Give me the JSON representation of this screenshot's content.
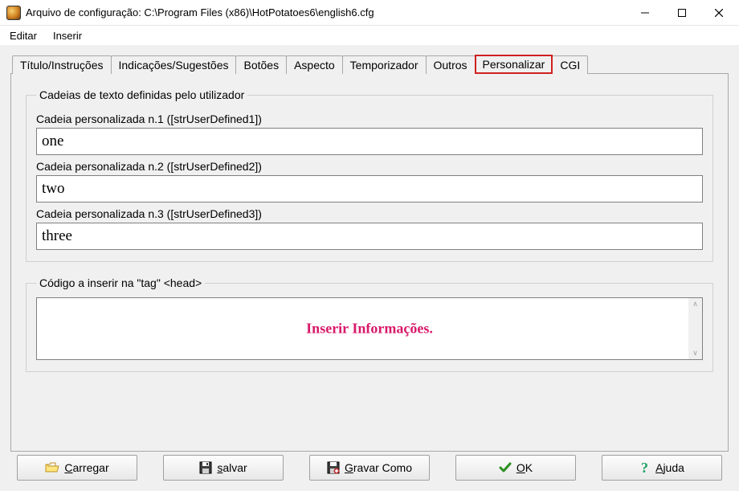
{
  "title": "Arquivo de configuração: C:\\Program Files (x86)\\HotPotatoes6\\english6.cfg",
  "menu": {
    "editar": "Editar",
    "inserir": "Inserir"
  },
  "tabs": {
    "titulo": "Título/Instruções",
    "indicacoes": "Indicações/Sugestões",
    "botoes": "Botões",
    "aspecto": "Aspecto",
    "temporizador": "Temporizador",
    "outros": "Outros",
    "personalizar": "Personalizar",
    "cgi": "CGI"
  },
  "group1": {
    "legend": "Cadeias de texto definidas pelo utilizador",
    "label1": "Cadeia personalizada n.1 ([strUserDefined1])",
    "value1": "one",
    "label2": "Cadeia personalizada n.2 ([strUserDefined2])",
    "value2": "two",
    "label3": "Cadeia personalizada n.3 ([strUserDefined3])",
    "value3": "three"
  },
  "group2": {
    "legend": "Código a inserir na \"tag\" <head>",
    "annotation": "Inserir Informações."
  },
  "buttons": {
    "carregar": "Carregar",
    "salvar": "salvar",
    "gravar": "Gravar Como",
    "ok": "OK",
    "ajuda": "Ajuda"
  }
}
